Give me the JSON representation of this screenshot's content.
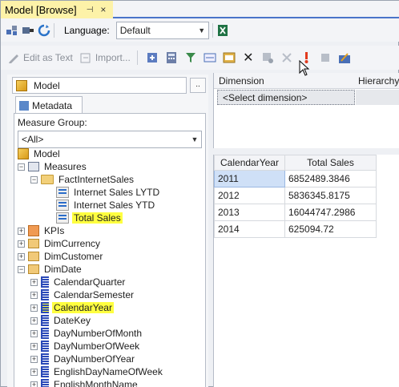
{
  "window": {
    "title": "Model [Browse]",
    "pin": "⊣",
    "close": "×"
  },
  "toolbar1": {
    "language_label": "Language:",
    "language_value": "Default"
  },
  "toolbar2": {
    "edit_as_text": "Edit as Text",
    "import": "Import..."
  },
  "left": {
    "model_field": "Model",
    "dots": "..",
    "metadata_tab": "Metadata",
    "measure_group_label": "Measure Group:",
    "measure_group_value": "<All>"
  },
  "tree": [
    {
      "label": "Model",
      "icon": "cube-icon"
    },
    {
      "label": "Measures",
      "icon": "measures-icon"
    },
    {
      "label": "FactInternetSales",
      "icon": "folder-icon"
    },
    {
      "label": "Internet Sales LYTD",
      "icon": "calc-measure-icon"
    },
    {
      "label": "Internet Sales YTD",
      "icon": "calc-measure-icon"
    },
    {
      "label": "Total Sales",
      "icon": "calc-measure-icon",
      "highlight": true
    },
    {
      "label": "KPIs",
      "icon": "kpi-icon"
    },
    {
      "label": "DimCurrency",
      "icon": "dimension-icon"
    },
    {
      "label": "DimCustomer",
      "icon": "dimension-icon"
    },
    {
      "label": "DimDate",
      "icon": "dimension-icon"
    },
    {
      "label": "CalendarQuarter",
      "icon": "attribute-icon"
    },
    {
      "label": "CalendarSemester",
      "icon": "attribute-icon"
    },
    {
      "label": "CalendarYear",
      "icon": "attribute-icon",
      "highlight": true
    },
    {
      "label": "DateKey",
      "icon": "attribute-icon"
    },
    {
      "label": "DayNumberOfMonth",
      "icon": "attribute-icon"
    },
    {
      "label": "DayNumberOfWeek",
      "icon": "attribute-icon"
    },
    {
      "label": "DayNumberOfYear",
      "icon": "attribute-icon"
    },
    {
      "label": "EnglishDayNameOfWeek",
      "icon": "attribute-icon"
    },
    {
      "label": "EnglishMonthName",
      "icon": "attribute-icon"
    }
  ],
  "filter": {
    "dimension_header": "Dimension",
    "hierarchy_header": "Hierarchy",
    "select_dimension": "<Select dimension>"
  },
  "results": {
    "headers": [
      "CalendarYear",
      "Total Sales"
    ],
    "rows": [
      [
        "2011",
        "6852489.3846"
      ],
      [
        "2012",
        "5836345.8175"
      ],
      [
        "2013",
        "16044747.2986"
      ],
      [
        "2014",
        "625094.72"
      ]
    ]
  }
}
